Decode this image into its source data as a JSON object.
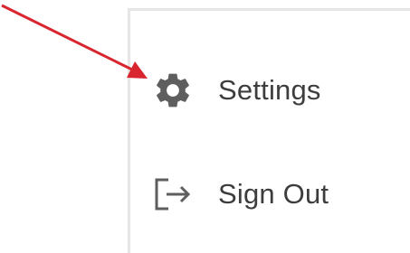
{
  "menu": {
    "items": [
      {
        "label": "Settings",
        "icon": "gear-icon"
      },
      {
        "label": "Sign Out",
        "icon": "sign-out-icon"
      }
    ]
  },
  "annotation": {
    "arrow_color": "#d9252f"
  },
  "colors": {
    "icon": "#5e5e5e",
    "text": "#3d3d3d",
    "panel_border": "#e6e6e6"
  }
}
